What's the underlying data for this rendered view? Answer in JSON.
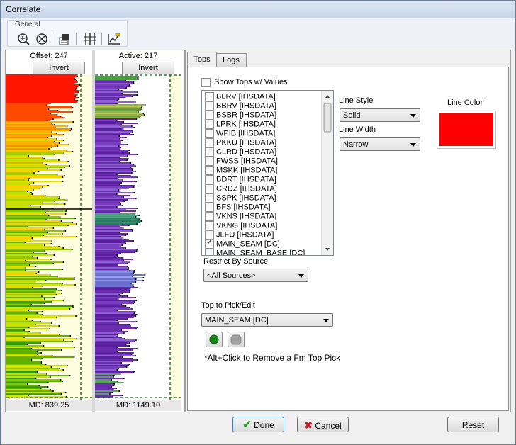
{
  "window": {
    "title": "Correlate"
  },
  "toolbar": {
    "group_title": "General",
    "buttons": [
      "zoom-in-icon",
      "zoom-out-icon",
      "export-icon",
      "track-lines-icon",
      "edit-pick-icon"
    ]
  },
  "left": {
    "offset_label": "Offset: 247",
    "active_label": "Active: 217",
    "invert_label": "Invert",
    "md_left": "MD: 839.25",
    "md_right": "MD: 1149.10"
  },
  "tabs": {
    "tops": "Tops",
    "logs": "Logs"
  },
  "tops": {
    "show_tops_label": "Show Tops w/ Values",
    "items": [
      {
        "label": "BLRV [IHSDATA]",
        "checked": false
      },
      {
        "label": "BBRV [IHSDATA]",
        "checked": false
      },
      {
        "label": "BSBR [IHSDATA]",
        "checked": false
      },
      {
        "label": "LPRK [IHSDATA]",
        "checked": false
      },
      {
        "label": "WPIB [IHSDATA]",
        "checked": false
      },
      {
        "label": "PKKU [IHSDATA]",
        "checked": false
      },
      {
        "label": "CLRD [IHSDATA]",
        "checked": false
      },
      {
        "label": "FWSS [IHSDATA]",
        "checked": false
      },
      {
        "label": "MSKK [IHSDATA]",
        "checked": false
      },
      {
        "label": "BDRT [IHSDATA]",
        "checked": false
      },
      {
        "label": "CRDZ [IHSDATA]",
        "checked": false
      },
      {
        "label": "SSPK [IHSDATA]",
        "checked": false
      },
      {
        "label": "BFS [IHSDATA]",
        "checked": false
      },
      {
        "label": "VKNS [IHSDATA]",
        "checked": false
      },
      {
        "label": "VKNG [IHSDATA]",
        "checked": false
      },
      {
        "label": "JLFU [IHSDATA]",
        "checked": false
      },
      {
        "label": "MAIN_SEAM [DC]",
        "checked": true
      },
      {
        "label": "MAIN_SEAM_BASE [DC]",
        "checked": false
      }
    ],
    "restrict_label": "Restrict By Source",
    "restrict_value": "<All Sources>",
    "line_style_label": "Line Style",
    "line_style_value": "Solid",
    "line_width_label": "Line Width",
    "line_width_value": "Narrow",
    "line_color_label": "Line Color",
    "line_color": "#ff0000",
    "top_pick_label": "Top to Pick/Edit",
    "top_pick_value": "MAIN_SEAM [DC]",
    "hint": "*Alt+Click to Remove a Fm Top Pick"
  },
  "buttons": {
    "done": "Done",
    "cancel": "Cancel",
    "reset": "Reset"
  },
  "colors": {
    "pick_green": "#1a8a1a",
    "log_purple": "#6a2db0",
    "track_background": "#fffde0"
  }
}
